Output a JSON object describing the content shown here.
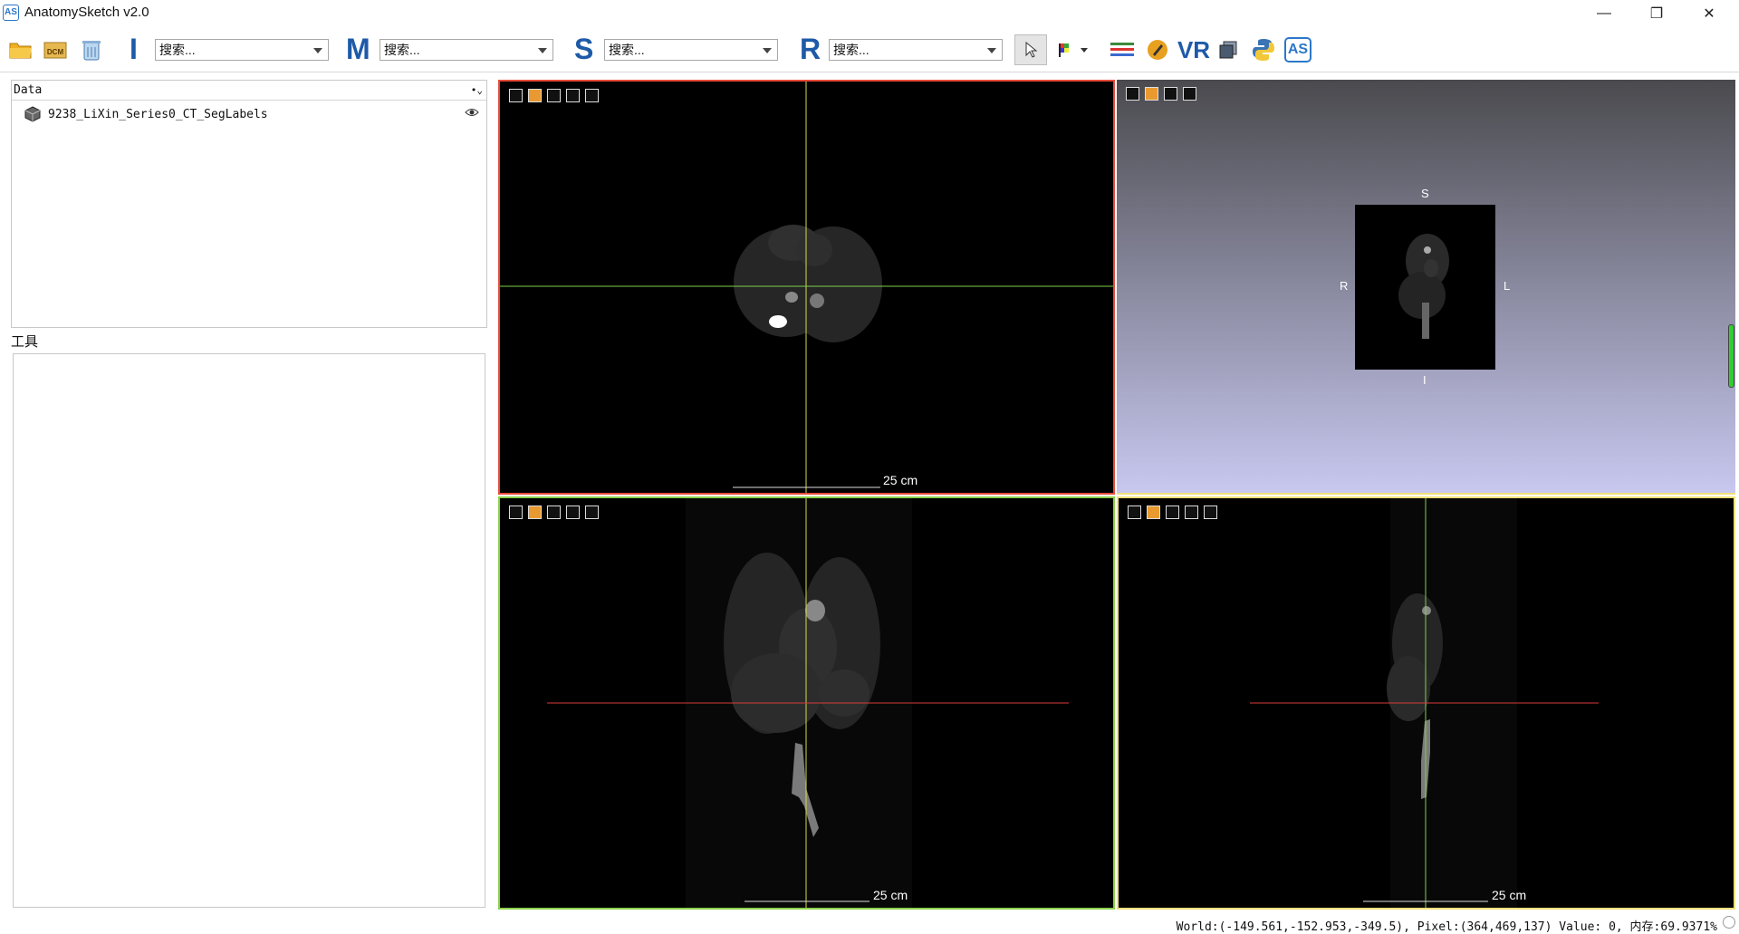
{
  "window": {
    "title": "AnatomySketch v2.0",
    "icon_text": "AS",
    "minimize_glyph": "—",
    "maximize_glyph": "❐",
    "close_glyph": "✕"
  },
  "toolbar": {
    "icons": [
      "open-folder-icon",
      "dicom-icon",
      "recycle-bin-icon"
    ],
    "groups": [
      {
        "letter": "I",
        "placeholder": "搜索..."
      },
      {
        "letter": "M",
        "placeholder": "搜索..."
      },
      {
        "letter": "S",
        "placeholder": "搜索..."
      },
      {
        "letter": "R",
        "placeholder": "搜索..."
      }
    ],
    "right_tools": [
      "pointer-icon",
      "colormap-icon",
      "layers-icon",
      "brush-icon",
      "vr-icon",
      "stack-icon",
      "python-icon",
      "as-logo-icon"
    ],
    "vr_label": "VR",
    "as_label": "AS"
  },
  "data_panel": {
    "header": "Data",
    "items": [
      {
        "label": "9238_LiXin_Series0_CT_SegLabels",
        "visible": true
      }
    ]
  },
  "tools_panel": {
    "title": "工具"
  },
  "views": {
    "axial": {
      "scale_label": "25 cm"
    },
    "volume": {
      "orient_top": "S",
      "orient_bottom": "I",
      "orient_left": "R",
      "orient_right": "L"
    },
    "coronal": {
      "scale_label": "25 cm"
    },
    "sagittal": {
      "scale_label": "25 cm"
    }
  },
  "colors": {
    "active_view_border": "#e84a3a",
    "view_border_green": "#8bd04a",
    "view_border_yellow": "#f0e07a",
    "crosshair_yellow": "#d8d84a",
    "crosshair_green": "#7fd04a",
    "crosshair_red": "#d83a3a",
    "brand_blue": "#1e5aa8"
  },
  "status": {
    "text": "World:(-149.561,-152.953,-349.5), Pixel:(364,469,137) Value: 0, 内存:69.9371%"
  }
}
